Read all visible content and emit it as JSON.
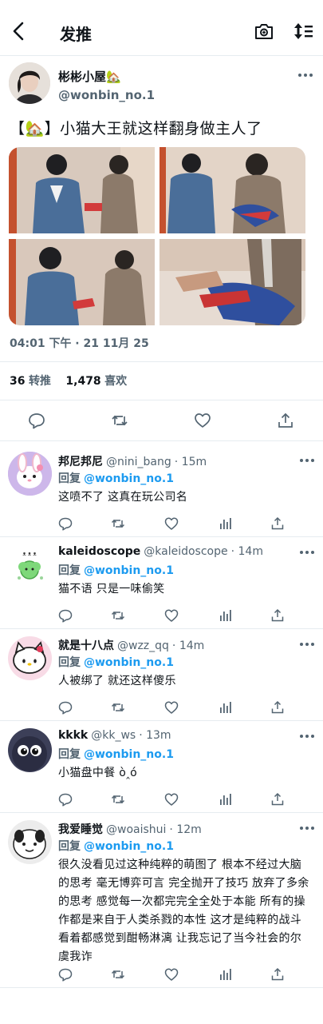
{
  "header": {
    "title": "发推",
    "back_icon": "back-arrow-icon",
    "camera_icon": "camera-icon",
    "sort_icon": "sort-icon"
  },
  "tweet": {
    "author_name": "彬彬小屋🏡",
    "author_handle": "@wonbin_no.1",
    "text": "【🏡】小猫大王就这样翻身做主人了",
    "timestamp": "04:01 下午 · 21 11月 25",
    "retweets": "36",
    "retweets_label": "转推",
    "likes": "1,478",
    "likes_label": "喜欢",
    "photos": [
      "photo-1",
      "photo-2",
      "photo-3",
      "photo-4"
    ]
  },
  "reply_prefix": "回复",
  "replies": [
    {
      "name": "邦尼邦尼",
      "handle": "@nini_bang",
      "time": "· 15m",
      "reply_to": "@wonbin_no.1",
      "lines": [
        "这喷不了 这真在玩公司名"
      ]
    },
    {
      "name": "kaleidoscope",
      "handle": "@kaleidoscope",
      "time": "· 14m",
      "reply_to": "@wonbin_no.1",
      "lines": [
        "猫不语 只是一味偷笑"
      ]
    },
    {
      "name": "就是十八点",
      "handle": "@wzz_qq",
      "time": "· 14m",
      "reply_to": "@wonbin_no.1",
      "lines": [
        "人被绑了 就还这样傻乐"
      ]
    },
    {
      "name": "kkkk",
      "handle": "@kk_ws",
      "time": "· 13m",
      "reply_to": "@wonbin_no.1",
      "lines": [
        "小猫盘中餐 ò‸ó"
      ]
    },
    {
      "name": "我爱睡觉",
      "handle": "@woaishui",
      "time": "· 12m",
      "reply_to": "@wonbin_no.1",
      "lines": [
        "很久没看见过这种纯粹的萌图了 根本不经过大脑",
        "的思考 毫无博弈可言 完全抛开了技巧 放弃了多余",
        "的思考 感觉每一次都完完全全处于本能 所有的操",
        "作都是来自于人类杀戮的本性 这才是纯粹的战斗",
        "看着都感觉到酣畅淋漓 让我忘记了当今社会的尔",
        "虞我诈"
      ]
    }
  ],
  "colors": {
    "accent": "#1d9bf0",
    "secondary": "#536471",
    "text": "#0f1419"
  }
}
